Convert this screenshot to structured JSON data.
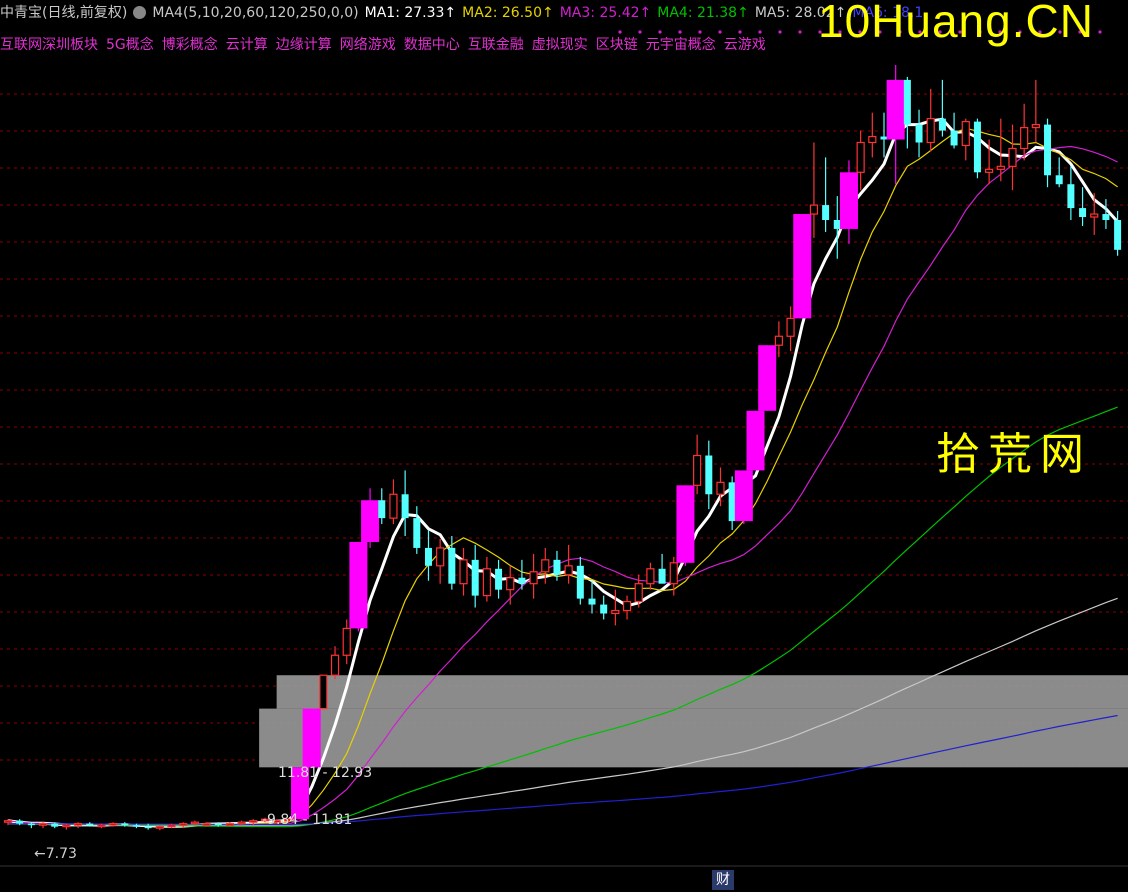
{
  "header": {
    "title": "中青宝(日线,前复权)",
    "ma_params": "MA4(5,10,20,60,120,250,0,0)",
    "ma1": "MA1: 27.33↑",
    "ma2": "MA2: 26.50↑",
    "ma3": "MA3: 25.42↑",
    "ma4_partial": "MA4: 21.38↑",
    "ma5": "MA5: 28.02↑",
    "ma6_partial": "MA6: 18.1"
  },
  "concepts": [
    "互联网深圳板块",
    "5G概念",
    "博彩概念",
    "云计算",
    "边缘计算",
    "网络游戏",
    "数据中心",
    "互联金融",
    "虚拟现实",
    "区块链",
    "元宇宙概念",
    "云游戏"
  ],
  "watermarks": {
    "top": "10Huang.CN",
    "mid": "拾荒网"
  },
  "zones": [
    {
      "label": "11.81 - 12.93",
      "low": 11.81,
      "high": 12.93
    },
    {
      "label": "-9.84 - 11.81",
      "low": 9.84,
      "high": 11.81
    }
  ],
  "low_marker": "←7.73",
  "footer_tag": "财",
  "colors": {
    "up": "#ff3232",
    "up_big": "#ff00ff",
    "down": "#54ffff",
    "ma1": "#ffffff",
    "ma2": "#e6d200",
    "ma3": "#d020d0",
    "ma4": "#00c000",
    "ma5": "#c8c8c8",
    "ma6": "#2020d0",
    "grid": "#8b0000",
    "zone": "#9a9a9a"
  },
  "chart_data": {
    "type": "candlestick",
    "ylim": [
      7.0,
      33.5
    ],
    "candles": [
      [
        8.0,
        8.1,
        7.9,
        8.05
      ],
      [
        8.05,
        8.1,
        7.9,
        7.95
      ],
      [
        7.95,
        8.0,
        7.8,
        7.9
      ],
      [
        7.9,
        8.0,
        7.8,
        7.95
      ],
      [
        7.95,
        8.0,
        7.8,
        7.85
      ],
      [
        7.85,
        7.95,
        7.75,
        7.9
      ],
      [
        7.9,
        8.0,
        7.8,
        7.95
      ],
      [
        7.95,
        8.0,
        7.85,
        7.9
      ],
      [
        7.9,
        7.95,
        7.8,
        7.9
      ],
      [
        7.9,
        8.0,
        7.85,
        7.95
      ],
      [
        7.95,
        8.0,
        7.85,
        7.9
      ],
      [
        7.9,
        7.95,
        7.8,
        7.85
      ],
      [
        7.85,
        7.95,
        7.75,
        7.8
      ],
      [
        7.8,
        7.9,
        7.73,
        7.85
      ],
      [
        7.85,
        7.95,
        7.8,
        7.9
      ],
      [
        7.9,
        8.0,
        7.8,
        7.95
      ],
      [
        7.95,
        8.05,
        7.9,
        8.0
      ],
      [
        7.9,
        8.0,
        7.85,
        7.95
      ],
      [
        7.95,
        8.0,
        7.85,
        7.9
      ],
      [
        7.9,
        8.0,
        7.85,
        7.95
      ],
      [
        7.95,
        8.05,
        7.9,
        8.0
      ],
      [
        8.0,
        8.1,
        7.9,
        8.05
      ],
      [
        8.05,
        8.15,
        8.0,
        8.1
      ],
      [
        8.0,
        8.1,
        7.95,
        8.05
      ],
      [
        8.05,
        8.1,
        8.0,
        8.1
      ],
      [
        8.1,
        9.84,
        8.1,
        9.84
      ],
      [
        9.84,
        11.81,
        9.84,
        11.81
      ],
      [
        11.81,
        12.93,
        11.81,
        12.93
      ],
      [
        12.93,
        13.9,
        12.8,
        13.6
      ],
      [
        13.6,
        14.8,
        13.3,
        14.5
      ],
      [
        14.5,
        17.4,
        14.4,
        17.4
      ],
      [
        17.4,
        19.2,
        17.2,
        18.8
      ],
      [
        18.8,
        19.2,
        18.0,
        18.2
      ],
      [
        18.2,
        19.5,
        18.0,
        19.0
      ],
      [
        19.0,
        19.8,
        17.6,
        18.2
      ],
      [
        18.2,
        18.6,
        17.0,
        17.2
      ],
      [
        17.2,
        17.8,
        16.1,
        16.6
      ],
      [
        16.6,
        17.5,
        16.0,
        17.2
      ],
      [
        17.2,
        17.6,
        15.8,
        16.0
      ],
      [
        16.0,
        17.2,
        15.6,
        16.8
      ],
      [
        16.8,
        17.3,
        15.2,
        15.6
      ],
      [
        15.6,
        16.9,
        15.4,
        16.5
      ],
      [
        16.5,
        16.8,
        15.5,
        15.8
      ],
      [
        15.8,
        16.6,
        15.3,
        16.2
      ],
      [
        16.2,
        16.8,
        15.8,
        16.0
      ],
      [
        16.0,
        17.0,
        15.5,
        16.4
      ],
      [
        16.4,
        17.2,
        16.0,
        16.8
      ],
      [
        16.8,
        17.1,
        16.1,
        16.3
      ],
      [
        16.3,
        17.3,
        16.0,
        16.6
      ],
      [
        16.6,
        16.9,
        15.3,
        15.5
      ],
      [
        15.5,
        16.1,
        15.0,
        15.3
      ],
      [
        15.3,
        15.6,
        14.8,
        15.0
      ],
      [
        15.0,
        15.8,
        14.6,
        15.1
      ],
      [
        15.1,
        15.6,
        14.8,
        15.4
      ],
      [
        15.4,
        16.3,
        15.2,
        16.0
      ],
      [
        16.0,
        16.7,
        15.8,
        16.5
      ],
      [
        16.5,
        17.0,
        16.2,
        16.0
      ],
      [
        16.0,
        16.9,
        15.6,
        16.7
      ],
      [
        16.7,
        19.3,
        16.6,
        19.3
      ],
      [
        19.3,
        21.0,
        19.0,
        20.3
      ],
      [
        20.3,
        20.8,
        18.5,
        19.0
      ],
      [
        19.0,
        19.9,
        18.6,
        19.4
      ],
      [
        19.4,
        19.6,
        17.8,
        18.1
      ],
      [
        18.1,
        19.8,
        18.0,
        19.8
      ],
      [
        19.8,
        21.8,
        19.8,
        21.8
      ],
      [
        21.8,
        24.0,
        21.8,
        24.0
      ],
      [
        24.0,
        24.8,
        23.6,
        24.3
      ],
      [
        24.3,
        25.3,
        23.8,
        24.9
      ],
      [
        24.9,
        28.4,
        24.9,
        28.4
      ],
      [
        28.4,
        30.8,
        27.6,
        28.7
      ],
      [
        28.7,
        30.3,
        27.8,
        28.2
      ],
      [
        28.2,
        29.0,
        26.9,
        27.9
      ],
      [
        27.9,
        30.2,
        27.4,
        29.8
      ],
      [
        29.8,
        31.2,
        29.2,
        30.8
      ],
      [
        30.8,
        31.8,
        30.3,
        31.0
      ],
      [
        31.0,
        31.8,
        30.3,
        30.9
      ],
      [
        30.9,
        33.4,
        29.4,
        32.9
      ],
      [
        32.9,
        33.0,
        30.6,
        31.4
      ],
      [
        31.4,
        31.9,
        30.3,
        30.8
      ],
      [
        30.8,
        32.6,
        30.5,
        31.6
      ],
      [
        31.6,
        32.9,
        31.0,
        31.2
      ],
      [
        31.2,
        31.8,
        30.6,
        30.7
      ],
      [
        30.7,
        31.6,
        30.2,
        31.5
      ],
      [
        31.5,
        31.6,
        29.6,
        29.8
      ],
      [
        29.8,
        30.9,
        29.4,
        29.9
      ],
      [
        29.9,
        31.6,
        29.5,
        30.0
      ],
      [
        30.0,
        31.4,
        29.2,
        30.6
      ],
      [
        30.6,
        32.1,
        30.2,
        31.3
      ],
      [
        31.3,
        32.9,
        30.8,
        31.4
      ],
      [
        31.4,
        31.6,
        29.3,
        29.7
      ],
      [
        29.7,
        30.3,
        29.3,
        29.4
      ],
      [
        29.4,
        30.0,
        28.2,
        28.6
      ],
      [
        28.6,
        29.3,
        28.0,
        28.3
      ],
      [
        28.3,
        29.1,
        27.7,
        28.4
      ],
      [
        28.4,
        28.9,
        27.9,
        28.2
      ],
      [
        28.2,
        28.5,
        27.0,
        27.2
      ]
    ],
    "ma_lines": [
      {
        "name": "MA1",
        "color": "#ffffff",
        "period": 5
      },
      {
        "name": "MA2",
        "color": "#e6d200",
        "period": 10
      },
      {
        "name": "MA3",
        "color": "#d020d0",
        "period": 20
      },
      {
        "name": "MA4",
        "color": "#00c000",
        "period": 60
      },
      {
        "name": "MA5",
        "color": "#c8c8c8",
        "period": 120
      },
      {
        "name": "MA6",
        "color": "#2020d0",
        "period": 250
      }
    ]
  }
}
